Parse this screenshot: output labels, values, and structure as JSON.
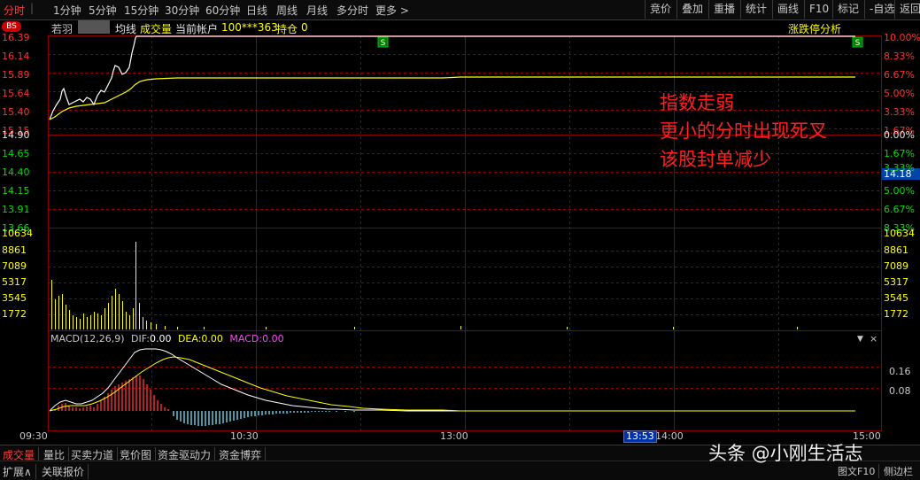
{
  "topbar": {
    "left_tabs": [
      "分时",
      "1分钟",
      "5分钟",
      "15分钟",
      "30分钟",
      "60分钟",
      "日线",
      "周线",
      "月线",
      "多分时",
      "更多 >"
    ],
    "right_buttons": [
      "竞价",
      "叠加",
      "重播",
      "统计",
      "画线",
      "F10",
      "标记",
      "-自选",
      "返回"
    ]
  },
  "info": {
    "bs_badge": "BS",
    "stock_name": "若羽",
    "avg_label": "均线",
    "volume_label": "成交量",
    "account_label": "当前帐户",
    "account_value": "100***363",
    "position_label": "持仓",
    "position_value": "0",
    "limit_analysis": "涨跌停分析"
  },
  "price_axis": {
    "left": [
      "16.39",
      "16.14",
      "15.89",
      "15.64",
      "15.40",
      "15.15",
      "14.90",
      "14.65",
      "14.40",
      "14.15",
      "13.91",
      "13.66"
    ],
    "right": [
      "10.00%",
      "8.33%",
      "6.67%",
      "5.00%",
      "3.33%",
      "1.67%",
      "0.00%",
      "1.67%",
      "3.33%",
      "5.00%",
      "6.67%",
      "8.33%"
    ],
    "current_price": "14.18"
  },
  "volume_axis": {
    "left": [
      "10634",
      "8861",
      "7089",
      "5317",
      "3545",
      "1772"
    ],
    "right": [
      "10634",
      "8861",
      "7089",
      "5317",
      "3545",
      "1772"
    ]
  },
  "macd": {
    "label": "MACD(12,26,9)",
    "dif_label": "DIF:",
    "dif_value": "0.00",
    "dea_label": "DEA:",
    "dea_value": "0.00",
    "macd_label": "MACD:",
    "macd_value": "0.00",
    "right_ticks": [
      "0.16",
      "0.08"
    ]
  },
  "time_axis": {
    "labels": [
      "09:30",
      "10:30",
      "13:00",
      "14:00",
      "15:00"
    ],
    "cursor_time": "13:53"
  },
  "annotation": {
    "lines": [
      "指数走弱",
      "更小的分时出现死叉",
      "该股封单减少"
    ]
  },
  "markers": [
    "S",
    "S"
  ],
  "bottom_tabs_row1": [
    "成交量",
    "量比",
    "买卖力道",
    "竞价图",
    "资金驱动力",
    "资金博弈"
  ],
  "bottom_tabs_row2": [
    "扩展∧",
    "关联报价"
  ],
  "bottom_right": [
    "图文F10",
    "侧边栏"
  ],
  "watermark": "头条 @小刚生活志",
  "colors": {
    "price_line": "#ffffff",
    "avg_line": "#ffff00",
    "grid": "#8b0000",
    "up": "#ff3030",
    "down": "#00e000",
    "macd_neg": "#66d9ef"
  }
}
